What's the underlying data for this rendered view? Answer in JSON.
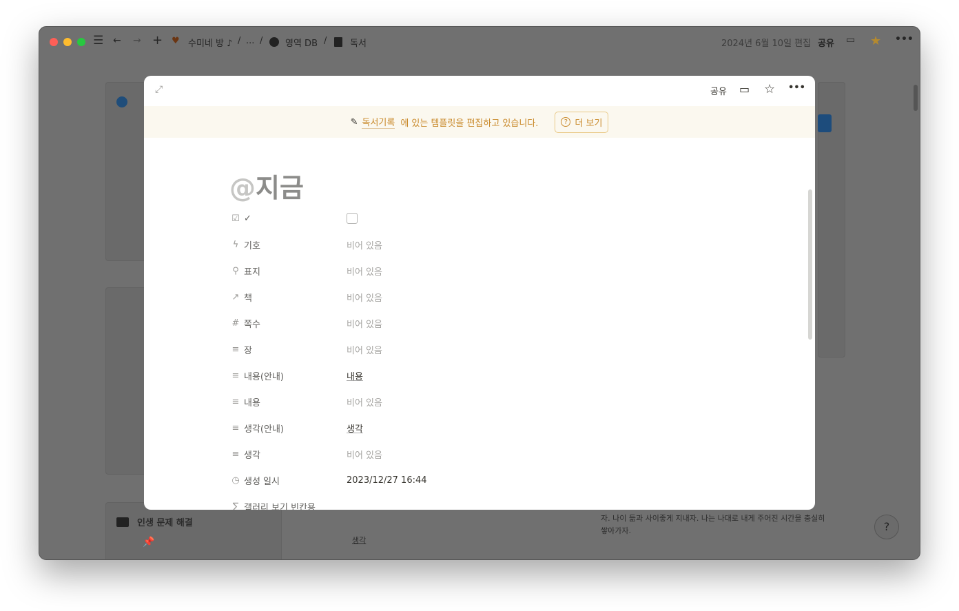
{
  "topbar": {
    "breadcrumbs": [
      {
        "icon": "strawberry-icon",
        "label": "수미네 방 ♪"
      },
      {
        "label": "..."
      },
      {
        "icon": "circle-icon",
        "label": "영역 DB"
      },
      {
        "icon": "book-icon",
        "label": "독서"
      }
    ],
    "separator": "/",
    "edited": "2024년 6월 10일 편집",
    "share": "공유",
    "star_color": "#b58a2e"
  },
  "background": {
    "section_title": "인생 문제 해결",
    "cell_link": "생각",
    "quote": "자. 나이 듦과 사이좋게 지내자. 나는 나대로 내게 주어진 시간을 충실히 쌓아가자."
  },
  "modal": {
    "share": "공유",
    "banner": {
      "link": "독서기록",
      "text": "에 있는 템플릿을 편집하고 있습니다.",
      "more": "더 보기"
    },
    "title_prefix": "@",
    "title": "지금",
    "properties": [
      {
        "icon": "checkbox-icon",
        "label": "✓",
        "value": "",
        "type": "checkbox",
        "checked": false
      },
      {
        "icon": "bolt-icon",
        "label": "기호",
        "value": "비어 있음"
      },
      {
        "icon": "search-icon",
        "label": "표지",
        "value": "비어 있음"
      },
      {
        "icon": "relation-arrow-icon",
        "label": "책",
        "value": "비어 있음"
      },
      {
        "icon": "number-icon",
        "label": "쪽수",
        "value": "비어 있음"
      },
      {
        "icon": "text-icon",
        "label": "장",
        "value": "비어 있음"
      },
      {
        "icon": "text-icon",
        "label": "내용(안내)",
        "value": "내용",
        "style": "link"
      },
      {
        "icon": "text-icon",
        "label": "내용",
        "value": "비어 있음"
      },
      {
        "icon": "text-icon",
        "label": "생각(안내)",
        "value": "생각",
        "style": "link"
      },
      {
        "icon": "text-icon",
        "label": "생각",
        "value": "비어 있음"
      },
      {
        "icon": "clock-icon",
        "label": "생성 일시",
        "value": "2023/12/27 16:44",
        "style": "dark"
      },
      {
        "icon": "sigma-icon",
        "label": "갤러리 보기 빈칸용",
        "value": ""
      }
    ]
  }
}
